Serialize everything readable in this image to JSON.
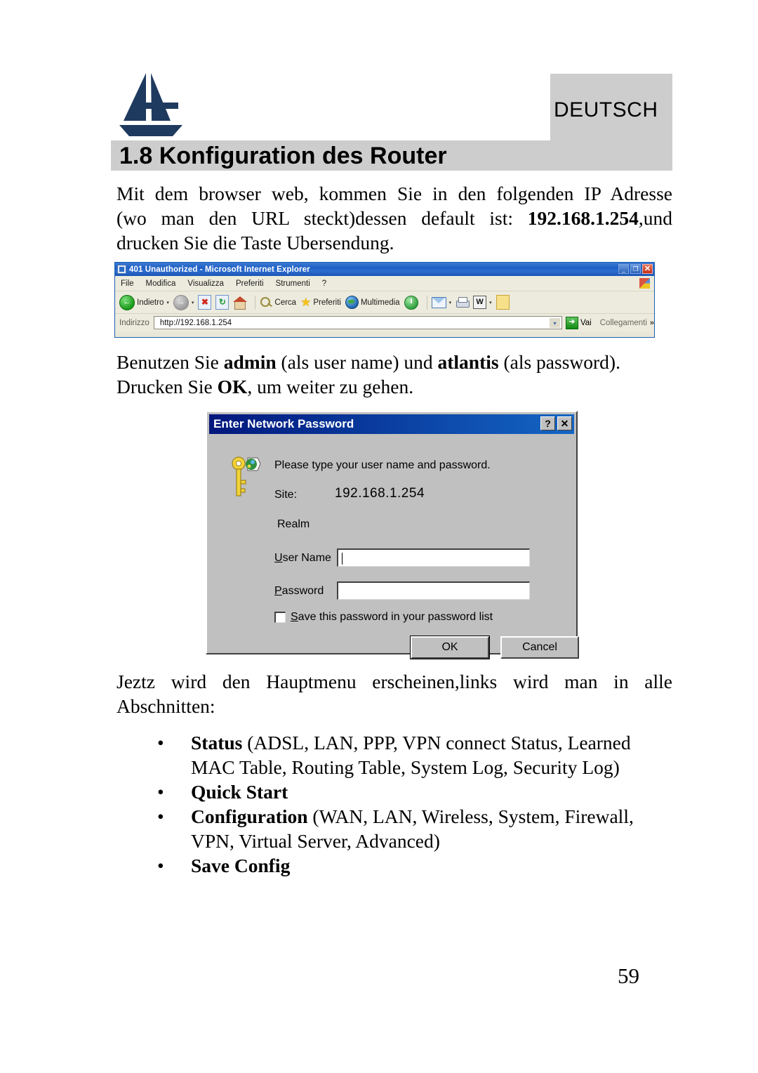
{
  "header": {
    "logo_name": "atlantis-land-logo",
    "language_badge": "DEUTSCH",
    "section_title": "1.8 Konfiguration des Router",
    "band_color": "#cdcdcd",
    "logo_color": "#1f3a5f"
  },
  "paragraphs": {
    "intro_line1": "Mit dem browser web, kommen Sie in den folgenden IP Adresse",
    "intro_line2_a": "(wo man den URL steckt)dessen default ist:",
    "intro_line2_ip": "192.168.1.254",
    "intro_line2_b": ",und",
    "intro_line3": "drucken Sie die Taste Ubersendung.",
    "login_line1_a": "Benutzen Sie ",
    "login_line1_user": "admin",
    "login_line1_b": " (als user name) und ",
    "login_line1_pass": "atlantis",
    "login_line1_c": " (als password).",
    "login_line2_a": "Drucken Sie ",
    "login_line2_ok": "OK",
    "login_line2_b": ", um weiter zu gehen.",
    "menu_line1": "Jeztz wird den Hauptmenu erscheinen,links wird man in alle",
    "menu_line2": "Abschnitten:"
  },
  "bullets": [
    {
      "marker": "•",
      "bold": "Status",
      "rest_line1": " (ADSL, LAN, PPP, VPN connect Status, Learned",
      "rest_line2": "MAC Table, Routing Table, System Log, Security Log)"
    },
    {
      "marker": "•",
      "bold": "Quick Start",
      "rest_line1": "",
      "rest_line2": ""
    },
    {
      "marker": "•",
      "bold": "Configuration",
      "rest_line1": " (WAN, LAN, Wireless, System, Firewall,",
      "rest_line2": "VPN, Virtual Server, Advanced)"
    },
    {
      "marker": "•",
      "bold": "Save Config",
      "rest_line1": "",
      "rest_line2": ""
    }
  ],
  "browser": {
    "title": "401 Unauthorized - Microsoft Internet Explorer",
    "window_buttons": {
      "minimize": "_",
      "restore": "❐",
      "close": "✕"
    },
    "menu": [
      "File",
      "Modifica",
      "Visualizza",
      "Preferiti",
      "Strumenti",
      "?"
    ],
    "toolbar": {
      "back_label": "Indietro",
      "back_caret": "▾",
      "forward_caret": "▾",
      "search_label": "Cerca",
      "favorites_label": "Preferiti",
      "multimedia_label": "Multimedia",
      "mail_caret": "▾",
      "edit_caret": "▾"
    },
    "address": {
      "label": "Indirizzo",
      "value": "http://192.168.1.254",
      "dropdown_caret": "▾",
      "go_label": "Vai",
      "go_arrow": "➔",
      "links_label": "Collegamenti",
      "links_chevron": "»"
    }
  },
  "password_dialog": {
    "title": "Enter Network Password",
    "help_button": "?",
    "close_button": "✕",
    "prompt": "Please type your user name and password.",
    "site_label": "Site:",
    "site_value": "192.168.1.254",
    "realm_label": "Realm",
    "user_label_underlined": "U",
    "user_label_rest": "ser Name",
    "user_value": "",
    "password_label_underlined": "P",
    "password_label_rest": "assword",
    "password_value": "",
    "save_checkbox_checked": false,
    "save_label_underlined": "S",
    "save_label_rest": "ave this password in your password list",
    "ok_label": "OK",
    "cancel_label": "Cancel"
  },
  "footer": {
    "page_number": "59"
  }
}
